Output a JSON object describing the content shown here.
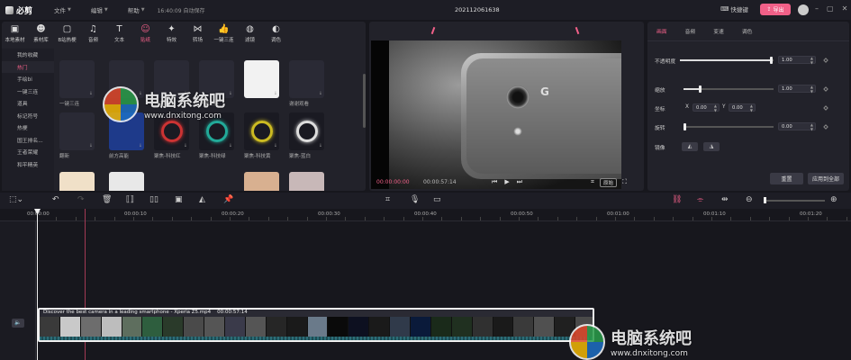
{
  "titlebar": {
    "app_name": "必剪",
    "menus": [
      "文件",
      "编辑",
      "帮助"
    ],
    "autosave": "16:40:09 自动保存",
    "project_name": "202112061638",
    "shortcut_label": "快捷键",
    "export_label": "导出"
  },
  "media": {
    "tools": [
      {
        "label": "本地素材",
        "icon": "folder-icon",
        "glyph": "▣"
      },
      {
        "label": "素材库",
        "icon": "library-icon",
        "glyph": "☻"
      },
      {
        "label": "B站热梗",
        "icon": "bilibili-icon",
        "glyph": "▢"
      },
      {
        "label": "音频",
        "icon": "music-icon",
        "glyph": "♫"
      },
      {
        "label": "文本",
        "icon": "text-icon",
        "glyph": "T"
      },
      {
        "label": "贴纸",
        "icon": "sticker-icon",
        "glyph": "☺"
      },
      {
        "label": "特效",
        "icon": "effect-icon",
        "glyph": "✦"
      },
      {
        "label": "转场",
        "icon": "transition-icon",
        "glyph": "⋈"
      },
      {
        "label": "一键三连",
        "icon": "like-icon",
        "glyph": "👍"
      },
      {
        "label": "滤镜",
        "icon": "filter-icon",
        "glyph": "◍"
      },
      {
        "label": "调色",
        "icon": "palette-icon",
        "glyph": "◐"
      }
    ],
    "categories": [
      "我的收藏",
      "热门",
      "手绘bi",
      "一键三连",
      "道具",
      "标记符号",
      "热梗",
      "国王排名...",
      "王者荣耀",
      "和平精英"
    ],
    "stickers": [
      {
        "name": "一键三连",
        "bg": "#1a1a22"
      },
      {
        "name": "",
        "bg": "#1a1a22"
      },
      {
        "name": "三连-蓝",
        "bg": "#1a1a22"
      },
      {
        "name": "一键三连",
        "bg": "#1a1a22"
      },
      {
        "name": "",
        "bg": "#f2f2f2"
      },
      {
        "name": "谢谢观看",
        "bg": "#1a1a22"
      },
      {
        "name": "翻新",
        "bg": "#1a1a22"
      },
      {
        "name": "前方高能",
        "bg": "#1a1a22"
      },
      {
        "name": "聚焦-科技红",
        "bg": "#1a1a22"
      },
      {
        "name": "聚焦-科技绿",
        "bg": "#1a1a22"
      },
      {
        "name": "聚焦-科技黄",
        "bg": "#1a1a22"
      },
      {
        "name": "聚焦-蓝白",
        "bg": "#1a1a22"
      }
    ],
    "sticker_texts": {
      "thank": "谢谢\n观看!",
      "high": "前方高能"
    }
  },
  "preview": {
    "current_time": "00:00:00:00",
    "total_time": "00:00:57:14",
    "original_label": "原始"
  },
  "props": {
    "tabs": [
      "画面",
      "音频",
      "变速",
      "调色"
    ],
    "opacity_label": "不透明度",
    "opacity_value": "1.00",
    "scale_label": "缩放",
    "scale_value": "1.00",
    "position_label": "坐标",
    "x_label": "X",
    "x_value": "0.00",
    "y_label": "Y",
    "y_value": "0.00",
    "rotate_label": "旋转",
    "rotate_value": "0.00",
    "mirror_label": "镜像",
    "reset_label": "重置",
    "apply_all_label": "应用到全部"
  },
  "timeline": {
    "ticks": [
      "00:00:00",
      "00:00:10",
      "00:00:20",
      "00:00:30",
      "00:00:40",
      "00:00:50",
      "00:01:00",
      "00:01:10",
      "00:01:20"
    ],
    "clip_title": "Discover the best camera in a leading smartphone - Xperia Z5.mp4",
    "clip_duration": "00:00:57:14"
  },
  "watermark": {
    "cn": "电脑系统吧",
    "url": "www.dnxitong.com"
  },
  "colors": {
    "accent": "#f06088",
    "bg": "#17171d",
    "panel": "#22222a"
  }
}
